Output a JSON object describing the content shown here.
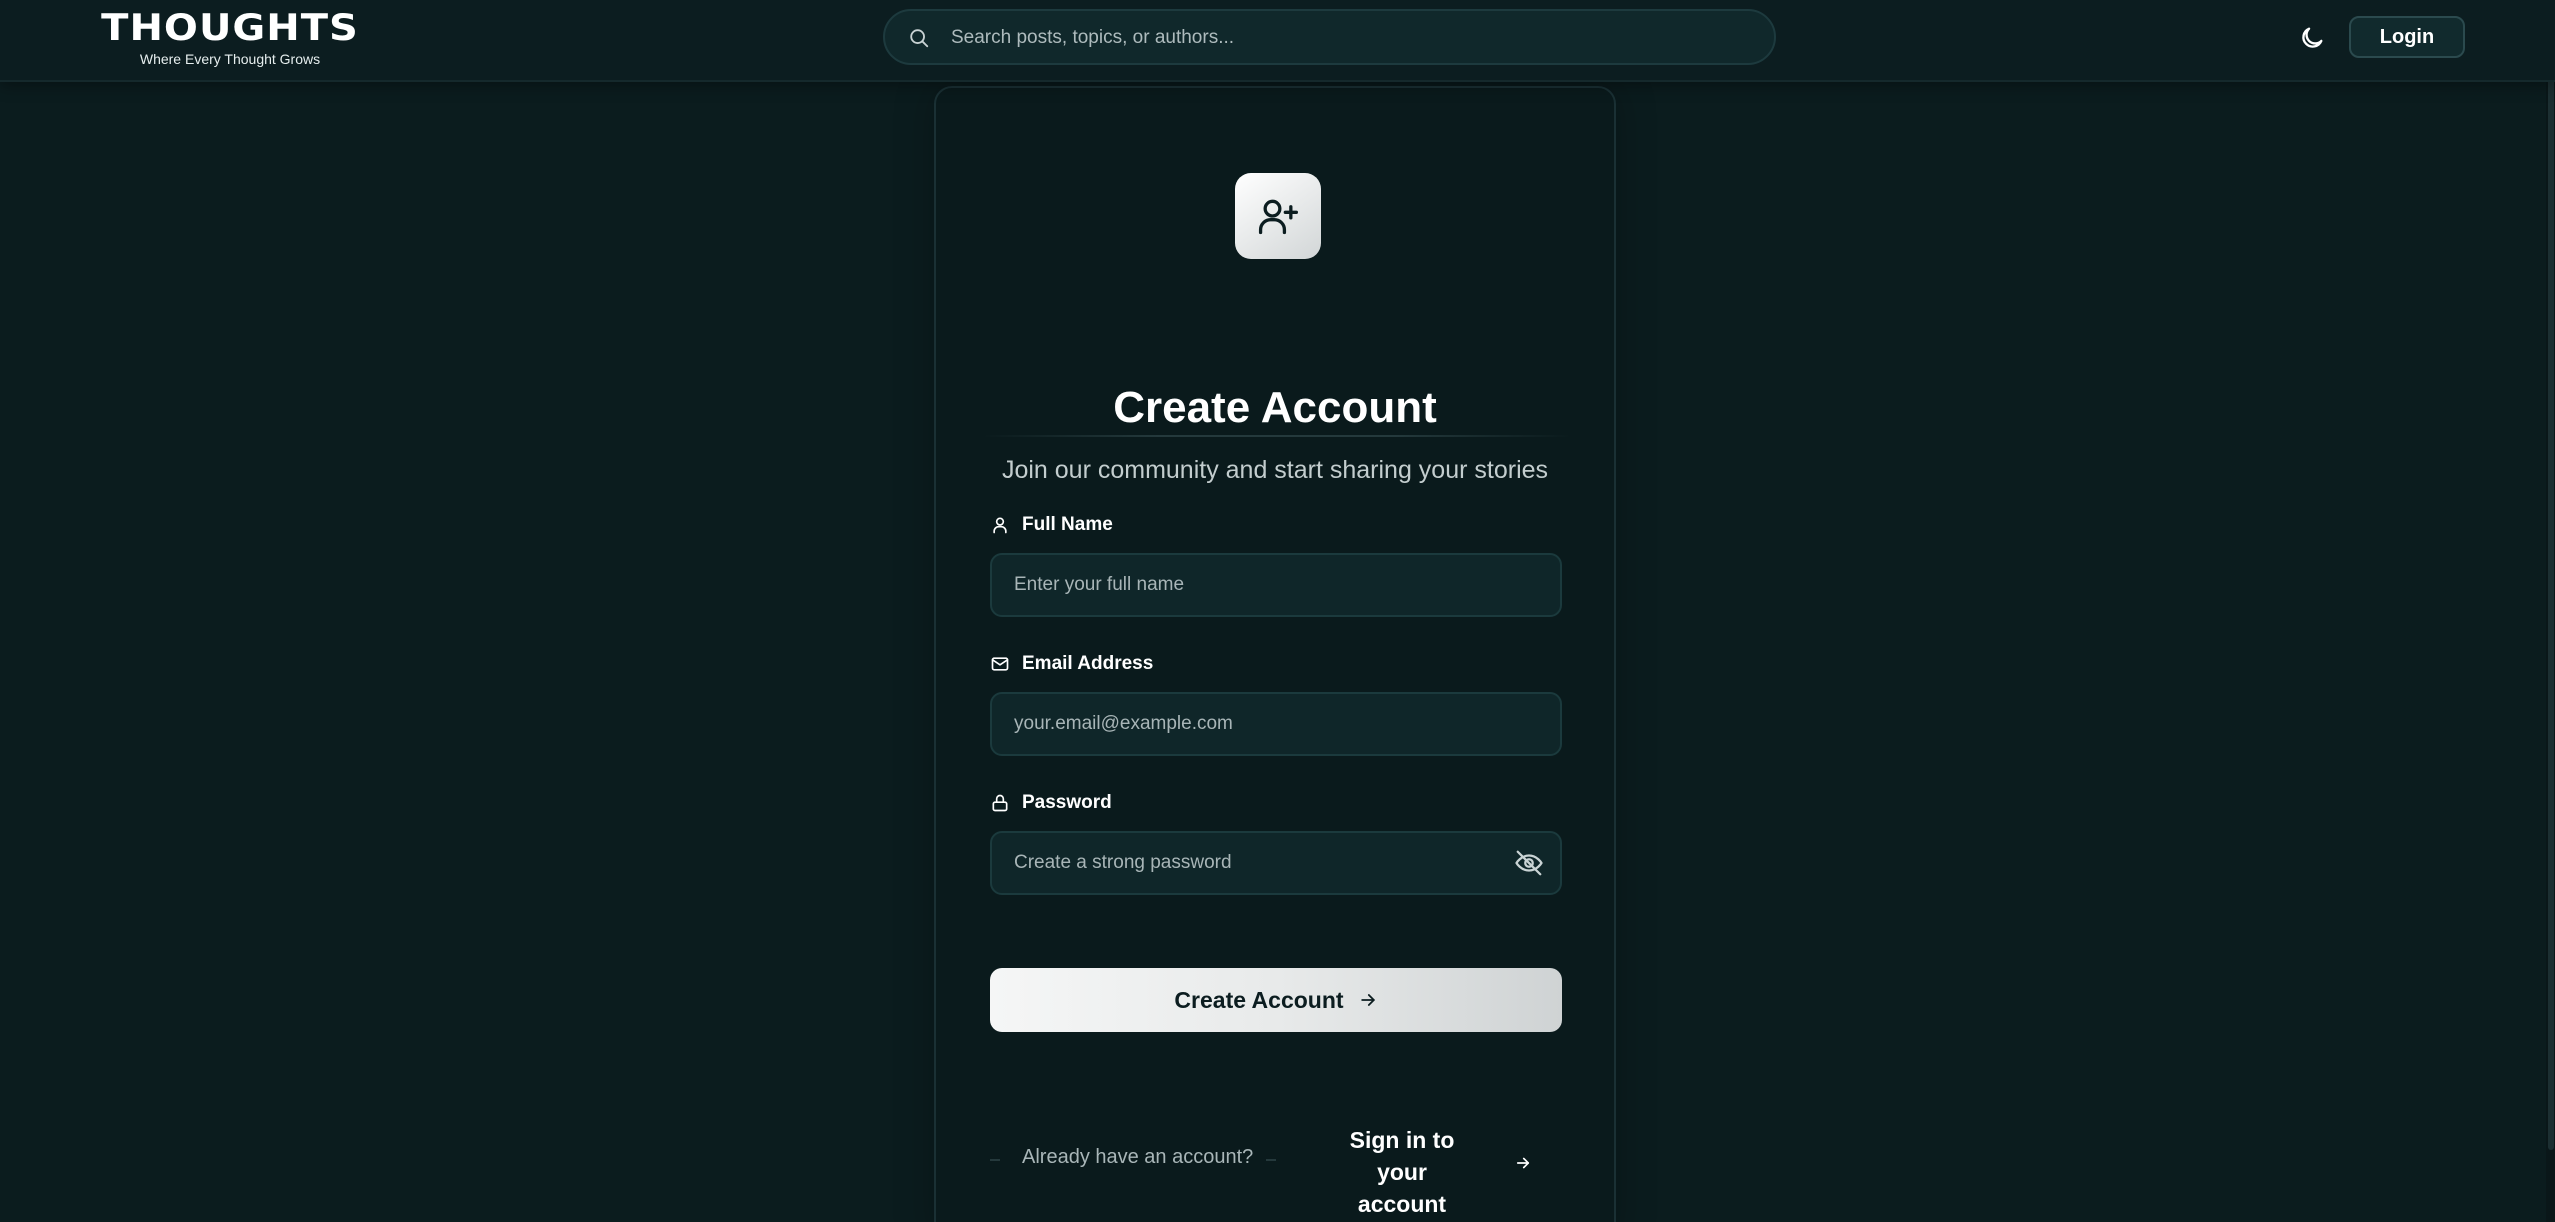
{
  "brand": {
    "name": "THOUGHTS",
    "tagline": "Where Every Thought Grows"
  },
  "header": {
    "search_placeholder": "Search posts, topics, or authors...",
    "theme_icon": "moon-icon",
    "login_label": "Login"
  },
  "signup": {
    "header_icon": "user-plus-icon",
    "title": "Create Account",
    "subtitle": "Join our community and start sharing your stories",
    "fields": [
      {
        "label": "Full Name",
        "icon": "user-icon",
        "placeholder": "Enter your full name",
        "value": ""
      },
      {
        "label": "Email Address",
        "icon": "mail-icon",
        "placeholder": "your.email@example.com",
        "value": ""
      },
      {
        "label": "Password",
        "icon": "lock-icon",
        "placeholder": "Create a strong password",
        "value": "",
        "visibility_icon": "eye-off-icon"
      }
    ],
    "submit_label": "Create Account",
    "submit_icon": "arrow-right-icon",
    "footer_prompt": "Already have an account?",
    "signin_label": "Sign in to your account",
    "signin_icon": "arrow-right-icon"
  },
  "colors": {
    "background": "#0b1c1e",
    "card": "#0a1a1c",
    "input": "#0f2629",
    "accent_button": "#f5f6f6"
  }
}
